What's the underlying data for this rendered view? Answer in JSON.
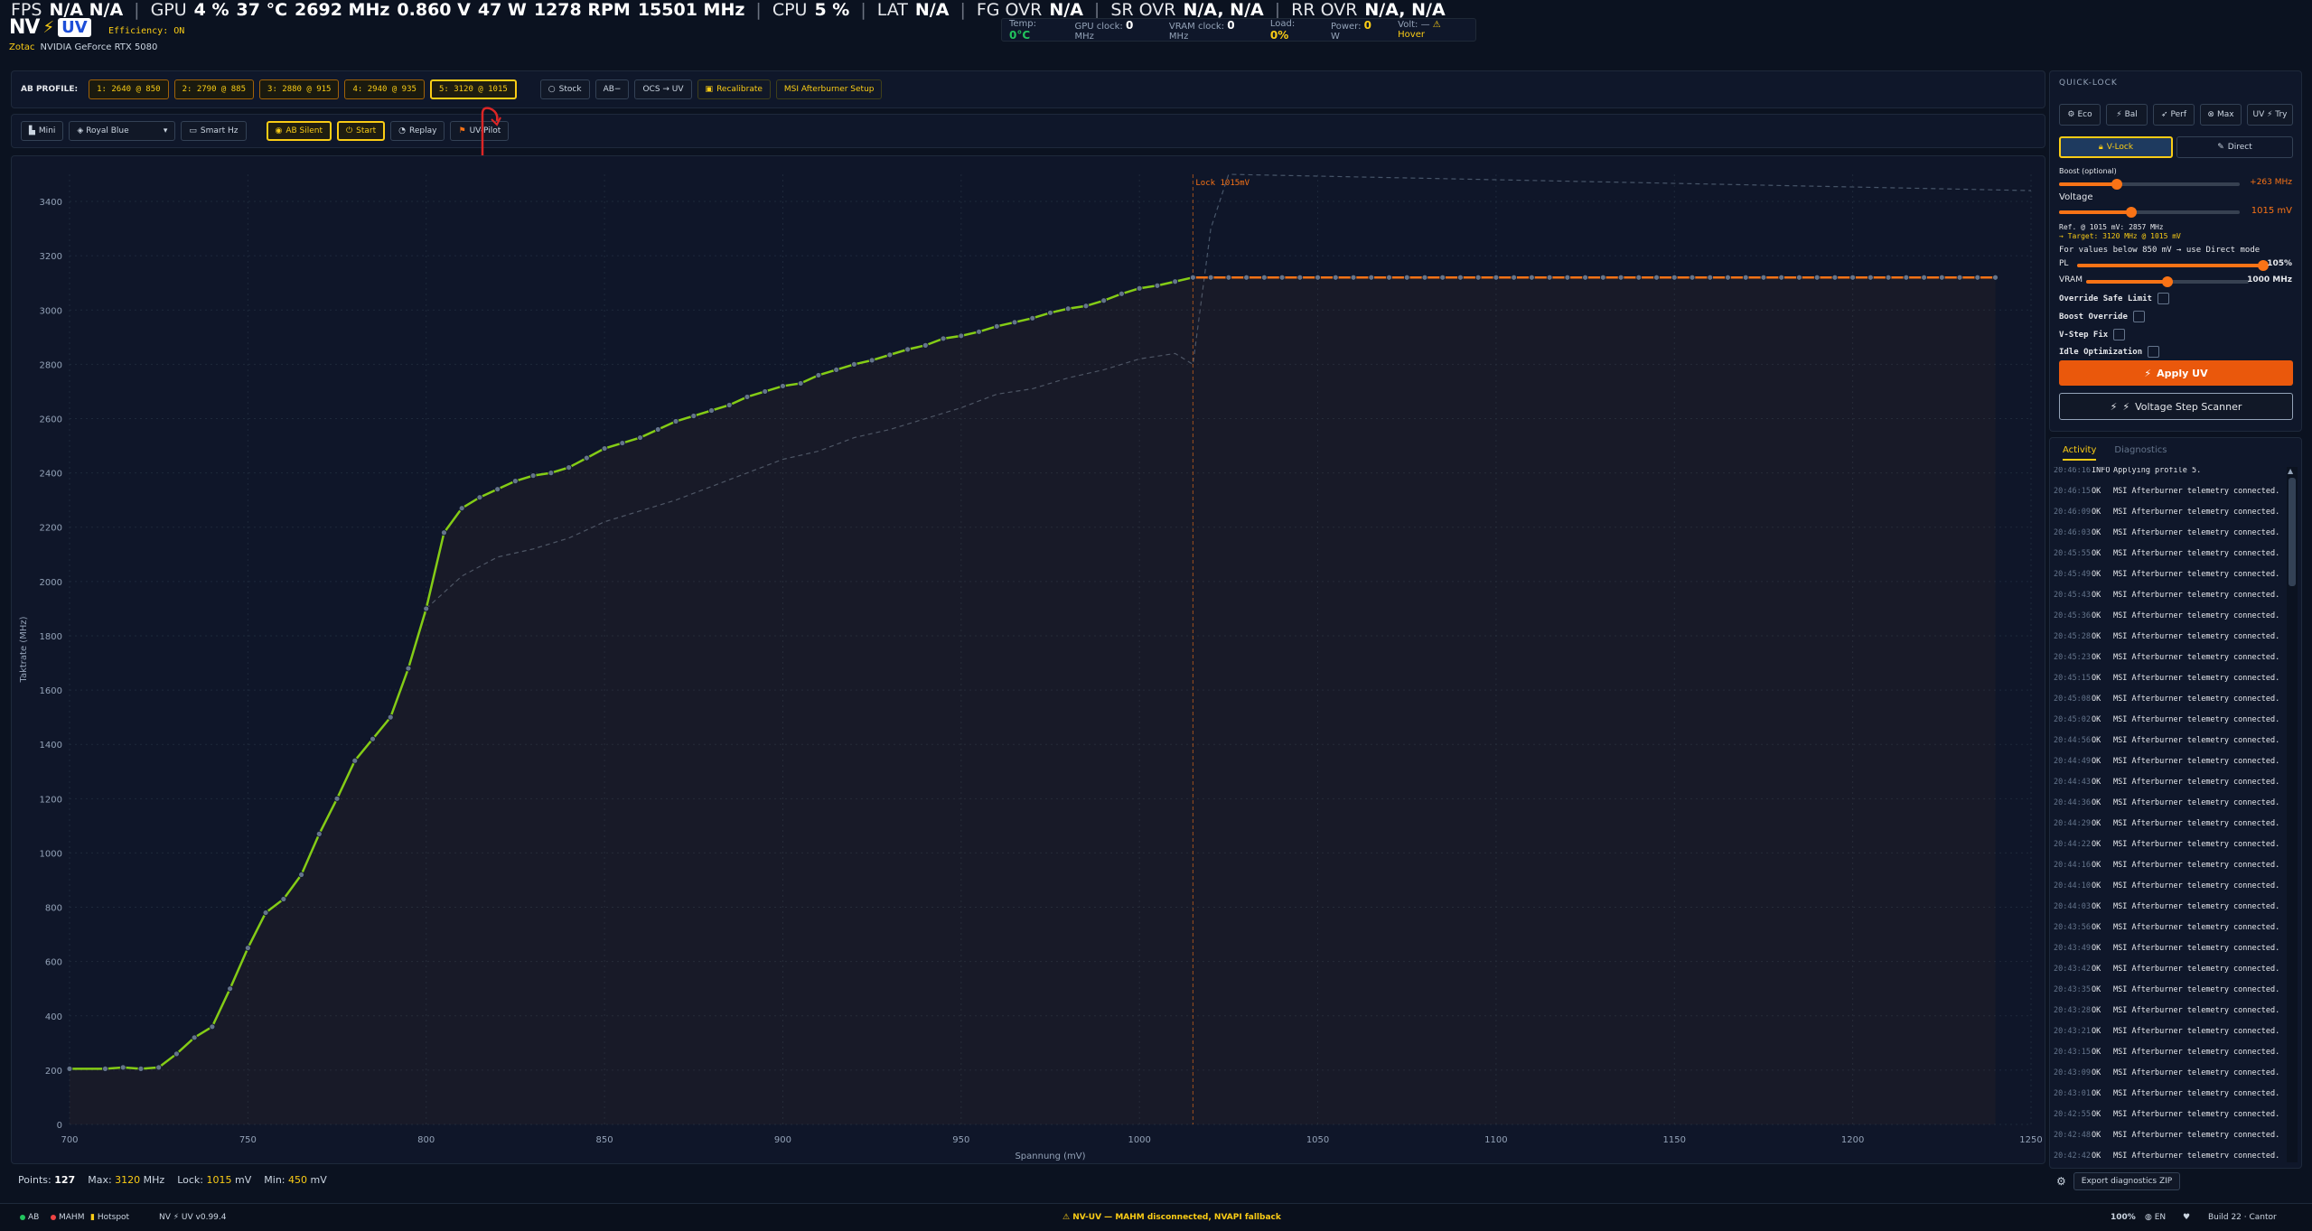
{
  "overlay": {
    "fps_label": "FPS",
    "fps_value": "N/A  N/A",
    "gpu_label": "GPU",
    "gpu_load": "4 %",
    "gpu_temp": "37 °C",
    "gpu_clock": "2692 MHz",
    "gpu_volt": "0.860 V",
    "gpu_power": "47 W",
    "gpu_fan": "1278 RPM",
    "gpu_mem": "15501 MHz",
    "cpu_label": "CPU",
    "cpu_value": "5 %",
    "lat_label": "LAT",
    "lat_value": "N/A",
    "fg_label": "FG OVR",
    "fg_value": "N/A",
    "sr_label": "SR OVR",
    "sr_value": "N/A,  N/A",
    "rr_label": "RR OVR",
    "rr_value": "N/A,  N/A"
  },
  "header": {
    "logo_nv": "NV",
    "logo_uv": "UV",
    "efficiency": "Efficiency: ON",
    "vendor": "Zotac",
    "gpu_name": "NVIDIA GeForce RTX 5080"
  },
  "telemetry": {
    "temp_label": "Temp:",
    "temp_value": "0°C",
    "gpu_clock_label": "GPU clock:",
    "gpu_clock_value": "0",
    "gpu_clock_unit": "MHz",
    "vram_clock_label": "VRAM clock:",
    "vram_clock_value": "0",
    "vram_clock_unit": "MHz",
    "load_label": "Load:",
    "load_value": "0%",
    "power_label": "Power:",
    "power_value": "0",
    "power_unit": "W",
    "volt_label": "Volt:",
    "volt_value": "—",
    "hover": "⚠ Hover"
  },
  "ab_profiles": {
    "label": "AB PROFILE:",
    "items": [
      "1: 2640 @ 850",
      "2: 2790 @ 885",
      "3: 2880 @ 915",
      "4: 2940 @ 935",
      "5: 3120 @ 1015"
    ],
    "stock": "Stock",
    "ab_minus": "AB−",
    "ocs_uv": "OCS → UV",
    "recalibrate": "Recalibrate",
    "msi_setup": "MSI Afterburner Setup"
  },
  "toolbar2": {
    "mini": "Mini",
    "theme": "Royal Blue",
    "smart_hz": "Smart Hz",
    "ab_silent": "AB Silent",
    "start": "Start",
    "replay": "Replay",
    "uv_pilot": "UV-Pilot"
  },
  "chart_data": {
    "type": "line",
    "xlabel": "Spannung (mV)",
    "ylabel": "Taktrate (MHz)",
    "xlim": [
      700,
      1250
    ],
    "ylim": [
      0,
      3500
    ],
    "xticks": [
      700,
      750,
      800,
      850,
      900,
      950,
      1000,
      1050,
      1100,
      1150,
      1200,
      1250
    ],
    "yticks": [
      0,
      200,
      400,
      600,
      800,
      1000,
      1200,
      1400,
      1600,
      1800,
      2000,
      2200,
      2400,
      2600,
      2800,
      3000,
      3200,
      3400
    ],
    "lock_label": "Lock 1015mV",
    "lock_x": 1015,
    "series": [
      {
        "x": [
          700,
          710,
          715,
          720,
          725,
          730,
          735,
          740,
          745,
          750,
          755,
          760,
          765,
          770,
          775,
          780,
          785,
          790,
          795,
          800,
          805,
          810,
          815,
          820,
          825,
          830,
          835,
          840,
          845,
          850,
          855,
          860,
          865,
          870,
          875,
          880,
          885,
          890,
          895,
          900,
          905,
          910,
          915,
          920,
          925,
          930,
          935,
          940,
          945,
          950,
          955,
          960,
          965,
          970,
          975,
          980,
          985,
          990,
          995,
          1000,
          1005,
          1010,
          1015
        ],
        "y": [
          205,
          205,
          210,
          205,
          210,
          260,
          320,
          360,
          500,
          650,
          780,
          830,
          920,
          1070,
          1200,
          1340,
          1420,
          1500,
          1680,
          1900,
          2180,
          2270,
          2310,
          2340,
          2370,
          2390,
          2400,
          2420,
          2455,
          2490,
          2510,
          2530,
          2560,
          2590,
          2610,
          2630,
          2650,
          2680,
          2700,
          2720,
          2730,
          2760,
          2780,
          2800,
          2815,
          2835,
          2855,
          2870,
          2895,
          2905,
          2920,
          2940,
          2955,
          2970,
          2990,
          3005,
          3015,
          3035,
          3060,
          3080,
          3090,
          3105,
          3120
        ]
      },
      {
        "x": [
          1015,
          1020,
          1025,
          1030,
          1035,
          1040,
          1045,
          1050,
          1055,
          1060,
          1065,
          1070,
          1075,
          1080,
          1085,
          1090,
          1095,
          1100,
          1105,
          1110,
          1115,
          1120,
          1125,
          1130,
          1135,
          1140,
          1145,
          1150,
          1155,
          1160,
          1165,
          1170,
          1175,
          1180,
          1185,
          1190,
          1195,
          1200,
          1205,
          1210,
          1215,
          1220,
          1225,
          1230,
          1235,
          1240
        ],
        "y": [
          3120,
          3120,
          3120,
          3120,
          3120,
          3120,
          3120,
          3120,
          3120,
          3120,
          3120,
          3120,
          3120,
          3120,
          3120,
          3120,
          3120,
          3120,
          3120,
          3120,
          3120,
          3120,
          3120,
          3120,
          3120,
          3120,
          3120,
          3120,
          3120,
          3120,
          3120,
          3120,
          3120,
          3120,
          3120,
          3120,
          3120,
          3120,
          3120,
          3120,
          3120,
          3120,
          3120,
          3120,
          3120,
          3120
        ]
      },
      {
        "x": [
          800,
          810,
          820,
          830,
          840,
          850,
          860,
          870,
          880,
          890,
          900,
          910,
          920,
          930,
          940,
          950,
          960,
          970,
          980,
          990,
          1000,
          1010,
          1015,
          1020,
          1025,
          1250
        ],
        "y": [
          1900,
          2020,
          2090,
          2120,
          2160,
          2220,
          2260,
          2300,
          2350,
          2400,
          2450,
          2480,
          2530,
          2560,
          2600,
          2640,
          2690,
          2710,
          2750,
          2780,
          2820,
          2840,
          2800,
          3300,
          3500,
          3440
        ]
      }
    ],
    "colors": {
      "green": "#84cc16",
      "orange": "#f97316",
      "baseline": "#475569",
      "lock": "#f97316",
      "point": "#64748b"
    }
  },
  "chart_footer": {
    "points_label": "Points:",
    "points_value": "127",
    "max_label": "Max:",
    "max_value": "3120",
    "max_unit": "MHz",
    "lock_label": "Lock:",
    "lock_value": "1015",
    "lock_unit": "mV",
    "min_label": "Min:",
    "min_value": "450",
    "min_unit": "mV"
  },
  "quick_lock": {
    "title": "QUICK-LOCK",
    "presets": [
      "Eco",
      "Bal",
      "Perf",
      "Max",
      "UV ⚡ Try"
    ],
    "v_lock": "V-Lock",
    "direct": "Direct",
    "boost_label": "Boost (optional)",
    "boost_value": "+263 MHz",
    "boost_level": 0.32,
    "voltage_label": "Voltage",
    "voltage_value": "1015 mV",
    "voltage_level": 0.4,
    "ref_text": "Ref. @ 1015 mV: 2857 MHz",
    "target_text": "→ Target: 3120 MHz @ 1015 mV",
    "below_text": "For values below 850 mV → use Direct mode",
    "pl_label": "PL",
    "pl_value": "105%",
    "pl_level": 1.0,
    "vram_label": "VRAM",
    "vram_value": "1000 MHz",
    "vram_level": 0.5,
    "override_safe": "Override Safe Limit",
    "boost_override": "Boost Override",
    "vstep_fix": "V-Step Fix",
    "idle_opt": "Idle Optimization",
    "apply": "Apply UV",
    "scanner": "Voltage Step Scanner"
  },
  "activity": {
    "tab_activity": "Activity",
    "tab_diag": "Diagnostics",
    "rows": [
      {
        "t": "20:46:16",
        "lv": "INFO",
        "m": "Applying profile 5."
      },
      {
        "t": "20:46:15",
        "lv": "OK",
        "m": "MSI Afterburner telemetry connected."
      },
      {
        "t": "20:46:09",
        "lv": "OK",
        "m": "MSI Afterburner telemetry connected."
      },
      {
        "t": "20:46:03",
        "lv": "OK",
        "m": "MSI Afterburner telemetry connected."
      },
      {
        "t": "20:45:55",
        "lv": "OK",
        "m": "MSI Afterburner telemetry connected."
      },
      {
        "t": "20:45:49",
        "lv": "OK",
        "m": "MSI Afterburner telemetry connected."
      },
      {
        "t": "20:45:43",
        "lv": "OK",
        "m": "MSI Afterburner telemetry connected."
      },
      {
        "t": "20:45:36",
        "lv": "OK",
        "m": "MSI Afterburner telemetry connected."
      },
      {
        "t": "20:45:28",
        "lv": "OK",
        "m": "MSI Afterburner telemetry connected."
      },
      {
        "t": "20:45:23",
        "lv": "OK",
        "m": "MSI Afterburner telemetry connected."
      },
      {
        "t": "20:45:15",
        "lv": "OK",
        "m": "MSI Afterburner telemetry connected."
      },
      {
        "t": "20:45:08",
        "lv": "OK",
        "m": "MSI Afterburner telemetry connected."
      },
      {
        "t": "20:45:02",
        "lv": "OK",
        "m": "MSI Afterburner telemetry connected."
      },
      {
        "t": "20:44:56",
        "lv": "OK",
        "m": "MSI Afterburner telemetry connected."
      },
      {
        "t": "20:44:49",
        "lv": "OK",
        "m": "MSI Afterburner telemetry connected."
      },
      {
        "t": "20:44:43",
        "lv": "OK",
        "m": "MSI Afterburner telemetry connected."
      },
      {
        "t": "20:44:36",
        "lv": "OK",
        "m": "MSI Afterburner telemetry connected."
      },
      {
        "t": "20:44:29",
        "lv": "OK",
        "m": "MSI Afterburner telemetry connected."
      },
      {
        "t": "20:44:22",
        "lv": "OK",
        "m": "MSI Afterburner telemetry connected."
      },
      {
        "t": "20:44:16",
        "lv": "OK",
        "m": "MSI Afterburner telemetry connected."
      },
      {
        "t": "20:44:10",
        "lv": "OK",
        "m": "MSI Afterburner telemetry connected."
      },
      {
        "t": "20:44:03",
        "lv": "OK",
        "m": "MSI Afterburner telemetry connected."
      },
      {
        "t": "20:43:56",
        "lv": "OK",
        "m": "MSI Afterburner telemetry connected."
      },
      {
        "t": "20:43:49",
        "lv": "OK",
        "m": "MSI Afterburner telemetry connected."
      },
      {
        "t": "20:43:42",
        "lv": "OK",
        "m": "MSI Afterburner telemetry connected."
      },
      {
        "t": "20:43:35",
        "lv": "OK",
        "m": "MSI Afterburner telemetry connected."
      },
      {
        "t": "20:43:28",
        "lv": "OK",
        "m": "MSI Afterburner telemetry connected."
      },
      {
        "t": "20:43:21",
        "lv": "OK",
        "m": "MSI Afterburner telemetry connected."
      },
      {
        "t": "20:43:15",
        "lv": "OK",
        "m": "MSI Afterburner telemetry connected."
      },
      {
        "t": "20:43:09",
        "lv": "OK",
        "m": "MSI Afterburner telemetry connected."
      },
      {
        "t": "20:43:01",
        "lv": "OK",
        "m": "MSI Afterburner telemetry connected."
      },
      {
        "t": "20:42:55",
        "lv": "OK",
        "m": "MSI Afterburner telemetry connected."
      },
      {
        "t": "20:42:48",
        "lv": "OK",
        "m": "MSI Afterburner telemetry connected."
      },
      {
        "t": "20:42:42",
        "lv": "OK",
        "m": "MSI Afterburner telemetry connected."
      }
    ],
    "export": "Export diagnostics ZIP"
  },
  "statusbar": {
    "ab": "AB",
    "mahm": "MAHM",
    "hotspot": "Hotspot",
    "version": "NV ⚡ UV v0.99.4",
    "warning": "⚠ NV-UV — MAHM disconnected, NVAPI fallback",
    "zoom": "100%",
    "lang": "EN",
    "build": "Build 22 · Cantor"
  }
}
